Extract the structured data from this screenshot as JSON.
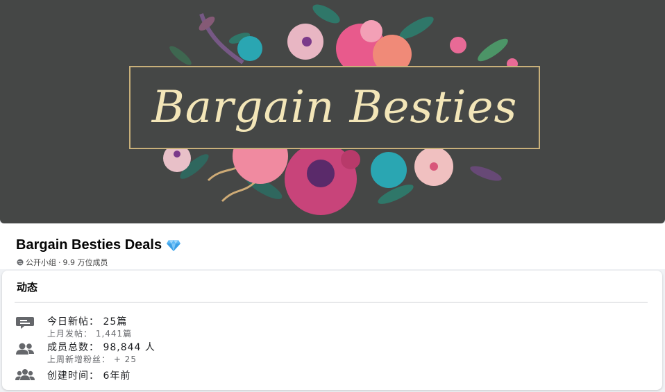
{
  "cover": {
    "title_art": "Bargain Besties"
  },
  "group": {
    "name": "Bargain Besties Deals",
    "privacy": "公开小组",
    "separator": "·",
    "members_short": "9.9 万位成员"
  },
  "activity": {
    "title": "动态",
    "stats": [
      {
        "icon": "chat-bubble-icon",
        "main": "今日新帖：  25篇",
        "sub": "上月发帖：  1,441篇"
      },
      {
        "icon": "members-icon",
        "main": "成员总数：  98,844 人",
        "sub": "上周新增粉丝：  + 25"
      },
      {
        "icon": "group-icon",
        "main": "创建时间：  6年前",
        "sub": ""
      }
    ]
  },
  "colors": {
    "cover_bg": "#454746",
    "frame": "#c8b07a",
    "title_script": "#f3e6b8",
    "icon_gray": "#65676b",
    "diamond": "#5cb8f5"
  }
}
